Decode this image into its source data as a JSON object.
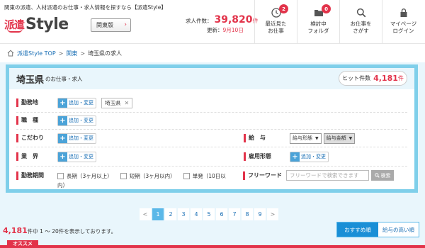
{
  "header": {
    "tagline": "関東の派遣、人材派遣のお仕事・求人情報を探すなら【派遣Style】",
    "logo_ha": "派遣",
    "logo_style": "Style",
    "region_button": "関東版",
    "jobs_label": "求人件数：",
    "jobs_count": "39,820",
    "jobs_unit": "件",
    "updated_label": "更新：",
    "updated_date": "9月10日",
    "nav": [
      {
        "label": "最近見た\nお仕事",
        "badge": "2",
        "icon": "clock-icon"
      },
      {
        "label": "検討中\nフォルダ",
        "badge": "0",
        "icon": "folder-icon"
      },
      {
        "label": "お仕事を\nさがす",
        "badge": "",
        "icon": "search-icon"
      },
      {
        "label": "マイページ\nログイン",
        "badge": "",
        "icon": "lock-icon"
      }
    ]
  },
  "breadcrumb": {
    "items": [
      "派遣Style TOP",
      "関東"
    ],
    "current": "埼玉県の求人",
    "separator": ">"
  },
  "search": {
    "title_pref": "埼玉県",
    "title_sub": "のお仕事・求人",
    "hits_label": "ヒット件数",
    "hits_count": "4,181",
    "hits_unit": "件",
    "add_label": "追加・変更",
    "location_label": "勤務地",
    "location_tag": "埼玉県",
    "occupation_label": "職　種",
    "kodawari_label": "こだわり",
    "salary_label": "給　与",
    "salary_type": "給与形態",
    "salary_amount": "給与金額",
    "industry_label": "業　界",
    "employment_label": "雇用形態",
    "period_label": "勤務期間",
    "period_long": "長期（3ヶ月以上）",
    "period_short": "短期（3ヶ月以内）",
    "period_single": "単発（10日以",
    "period_single_cont": "内）",
    "keyword_label": "フリーワード",
    "keyword_placeholder": "フリーワードで検索できます",
    "keyword_button": "検索"
  },
  "pager": {
    "prev": "<",
    "pages": [
      "1",
      "2",
      "3",
      "4",
      "5",
      "6",
      "7",
      "8",
      "9"
    ],
    "next": ">"
  },
  "result": {
    "count": "4,181",
    "text": "件中 1 ～ 20件を表示しております。"
  },
  "sort": {
    "recommended": "おすすめ順",
    "salary": "給与の高い順"
  },
  "section_tab": "オススメ",
  "colors": {
    "accent": "#e2334a",
    "brand_blue": "#1a6fb5",
    "panel_border": "#7fcfea"
  }
}
